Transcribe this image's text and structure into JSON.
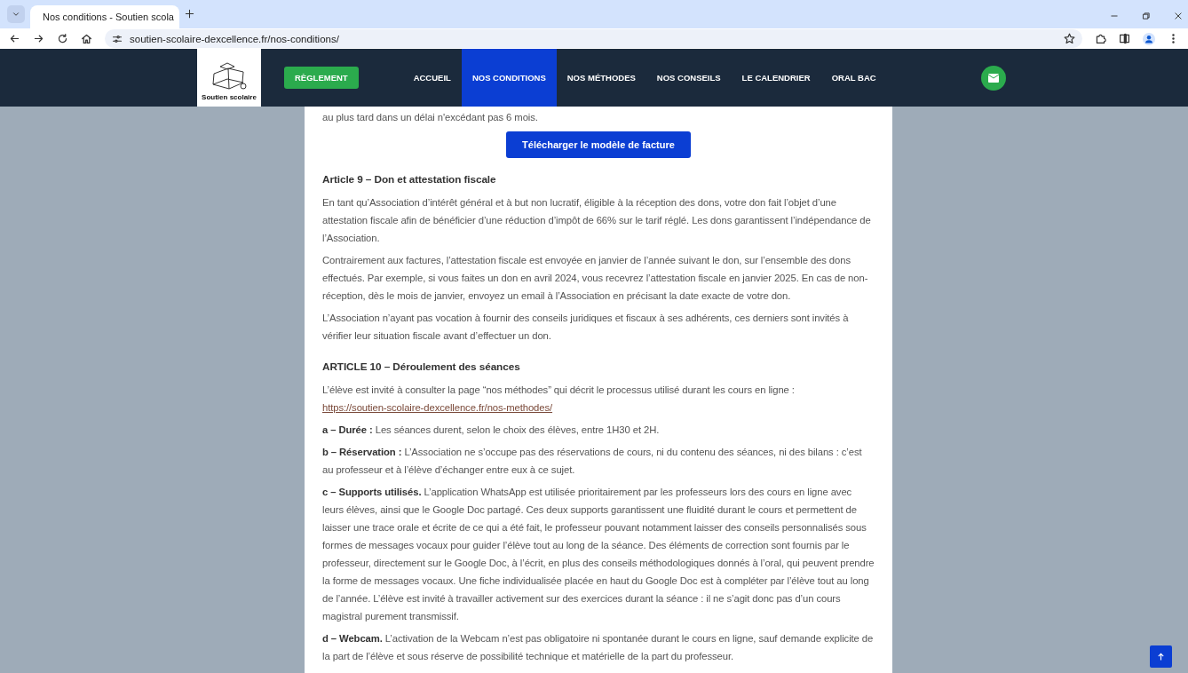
{
  "browser": {
    "tab_title": "Nos conditions - Soutien scola",
    "url": "soutien-scolaire-dexcellence.fr/nos-conditions/"
  },
  "header": {
    "logo_text": "Soutien scolaire",
    "cta": "RÈGLEMENT",
    "nav": [
      {
        "label": "ACCUEIL",
        "selected": false
      },
      {
        "label": "NOS CONDITIONS",
        "selected": true
      },
      {
        "label": "NOS MÉTHODES",
        "selected": false
      },
      {
        "label": "NOS CONSEILS",
        "selected": false
      },
      {
        "label": "LE CALENDRIER",
        "selected": false
      },
      {
        "label": "ORAL BAC",
        "selected": false
      }
    ]
  },
  "content": [
    {
      "kind": "paragraph",
      "text": "au plus tard dans un délai n'excédant pas 6 mois."
    },
    {
      "kind": "button",
      "text": "Télécharger le modèle de facture"
    },
    {
      "kind": "heading",
      "text": "Article 9 – Don et attestation fiscale"
    },
    {
      "kind": "paragraph",
      "text": "En tant qu’Association d’intérêt général et à but non lucratif, éligible à la réception des dons, votre don fait l’objet d’une attestation fiscale afin de bénéficier d’une réduction d’impôt de 66% sur le tarif réglé. Les dons garantissent l’indépendance de l’Association."
    },
    {
      "kind": "paragraph",
      "text": "Contrairement aux factures, l’attestation fiscale est envoyée en janvier de l’année suivant le don, sur l’ensemble des dons effectués. Par exemple, si vous faites un don en avril 2024, vous recevrez l’attestation fiscale en janvier 2025. En cas de non-réception, dès le mois de janvier, envoyez un email à l’Association en précisant la date exacte de votre don."
    },
    {
      "kind": "paragraph",
      "text": "L’Association n’ayant pas vocation à fournir des conseils juridiques et fiscaux à ses adhérents, ces derniers sont invités à vérifier leur situation fiscale avant d’effectuer un don."
    },
    {
      "kind": "heading",
      "text": "ARTICLE 10 – Déroulement des séances"
    },
    {
      "kind": "paragraph",
      "text": "L’élève est invité à consulter la page “nos méthodes” qui décrit le processus utilisé durant les cours en ligne : ",
      "link": "https://soutien-scolaire-dexcellence.fr/nos-methodes/"
    },
    {
      "kind": "paragraph",
      "text": "**a – Durée :** Les séances durent, selon le choix des élèves, entre 1H30 et 2H."
    },
    {
      "kind": "paragraph",
      "text": "**b – Réservation :** L’Association ne s’occupe pas des réservations de cours, ni du contenu des séances, ni des bilans : c’est au professeur et à l’élève d’échanger entre eux à ce sujet."
    },
    {
      "kind": "paragraph",
      "text": "**c – Supports utilisés.** L’application WhatsApp est utilisée prioritairement par les professeurs lors des cours en ligne avec leurs élèves, ainsi que le Google Doc partagé. Ces deux supports garantissent une fluidité durant le cours et permettent de laisser une trace orale et écrite de ce qui a été fait, le professeur pouvant notamment laisser des conseils personnalisés sous formes de messages vocaux pour guider l’élève tout au long de la séance. Des éléments de correction sont fournis par le professeur, directement sur le Google Doc, à l’écrit, en plus des conseils méthodologiques donnés à l’oral, qui peuvent prendre la forme de messages vocaux. Une fiche individualisée placée en haut du Google Doc est à compléter par l’élève tout au long de l’année. L’élève est invité à travailler activement sur des exercices durant la séance : il ne s’agit donc pas d’un cours magistral purement transmissif."
    },
    {
      "kind": "paragraph",
      "text": "**d – Webcam.** L’activation de la Webcam n’est pas obligatoire ni spontanée durant le cours en ligne, sauf demande explicite de la part de l’élève et sous réserve de possibilité technique et matérielle de la part du professeur."
    }
  ]
}
